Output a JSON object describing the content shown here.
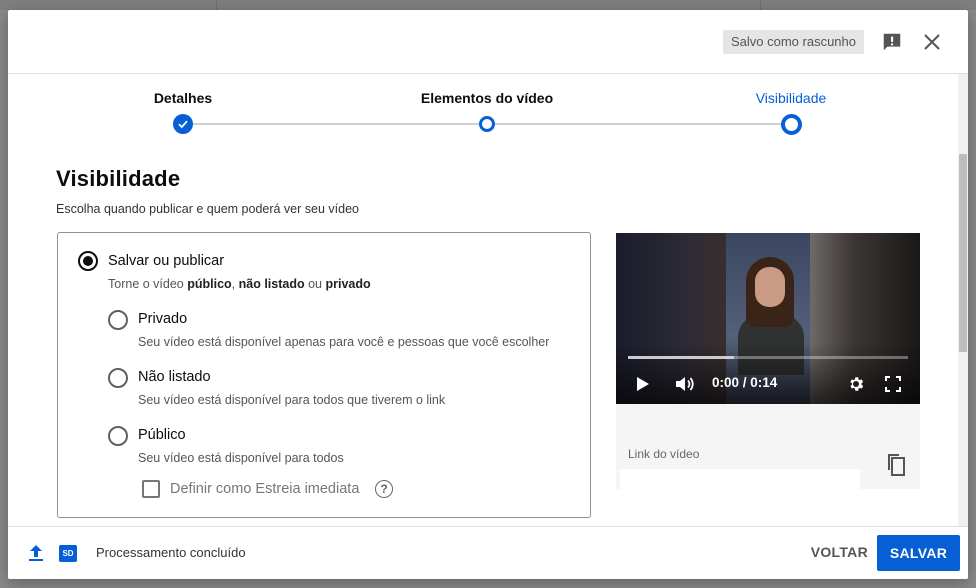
{
  "header": {
    "draft_status": "Salvo como rascunho",
    "feedback_icon": "feedback-icon",
    "close_icon": "close-icon"
  },
  "stepper": {
    "steps": [
      {
        "label": "Detalhes",
        "state": "done"
      },
      {
        "label": "Elementos do vídeo",
        "state": "done"
      },
      {
        "label": "Visibilidade",
        "state": "current"
      }
    ]
  },
  "visibility": {
    "title": "Visibilidade",
    "subtitle": "Escolha quando publicar e quem poderá ver seu vídeo",
    "save_option": {
      "label": "Salvar ou publicar",
      "desc_prefix": "Torne o vídeo ",
      "desc_public": "público",
      "desc_sep1": ", ",
      "desc_unlisted": "não listado",
      "desc_sep2": " ou ",
      "desc_private": "privado",
      "selected": true
    },
    "options": [
      {
        "label": "Privado",
        "desc": "Seu vídeo está disponível apenas para você e pessoas que você escolher"
      },
      {
        "label": "Não listado",
        "desc": "Seu vídeo está disponível para todos que tiverem o link"
      },
      {
        "label": "Público",
        "desc": "Seu vídeo está disponível para todos"
      }
    ],
    "premiere": {
      "label": "Definir como Estreia imediata",
      "checked": false
    }
  },
  "preview": {
    "current_time": "0:00",
    "duration": "0:14",
    "time_display": "0:00 / 0:14",
    "progress_fraction": 0.38,
    "link_label": "Link do vídeo"
  },
  "footer": {
    "quality_badge": "SD",
    "status": "Processamento concluído",
    "back_label": "VOLTAR",
    "save_label": "SALVAR"
  },
  "colors": {
    "accent": "#065fd4",
    "text": "#0d0d0d",
    "muted": "#555555"
  }
}
